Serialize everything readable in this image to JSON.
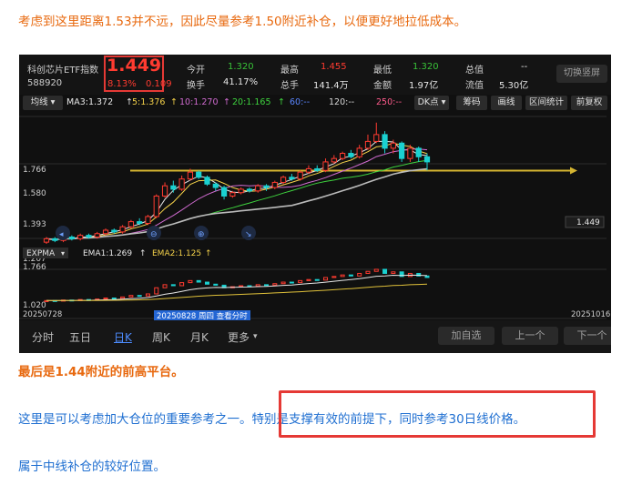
{
  "article": {
    "intro": "考虑到这里距离1.53并不远，因此尽量参考1.50附近补仓，以便更好地拉低成本。",
    "caption": "最后是1.44附近的前高平台。",
    "p2_plain": "这里是可以考虑加大仓位的重要参考之一。",
    "p2_highlight": "特别是支撑有效的前提下，同时参考30日线价格。",
    "p3": "属于中线补仓的较好位置。"
  },
  "quote": {
    "name": "科创芯片ETF指数",
    "code": "588920",
    "price": "1.449",
    "change_pct": "8.13%",
    "change_abs": "0.109",
    "stats": [
      {
        "label": "今开",
        "value": "1.320",
        "tone": "green"
      },
      {
        "label": "最高",
        "value": "1.455",
        "tone": "red"
      },
      {
        "label": "最低",
        "value": "1.320",
        "tone": "green"
      },
      {
        "label": "总值",
        "value": "--",
        "tone": "white"
      },
      {
        "label": "换手",
        "value": "41.17%",
        "tone": "white"
      },
      {
        "label": "总手",
        "value": "141.4万",
        "tone": "white"
      },
      {
        "label": "金额",
        "value": "1.97亿",
        "tone": "white"
      },
      {
        "label": "流值",
        "value": "5.30亿",
        "tone": "white"
      }
    ],
    "switch_button": "切换竖屏"
  },
  "toolbar": {
    "ma_select": "均线",
    "ma3": "MA3:1.372",
    "ma5": "5:1.376",
    "ma10": "10:1.270",
    "ma20": "20:1.165",
    "ma60": "60:--",
    "ma120": "120:--",
    "ma250": "250:--",
    "dk": "DK点",
    "chip": "筹码",
    "draw": "画线",
    "range": "区间统计",
    "adjust": "前复权"
  },
  "chart": {
    "y_labels": [
      "1.766",
      "1.580",
      "1.393",
      "1.207",
      "1.020"
    ],
    "price_tag": "1.449",
    "ema_select": "EXPMA",
    "ema1": "EMA1:1.269",
    "ema2": "EMA2:1.125",
    "sub_top": "1.766",
    "sub_bottom": "1.020",
    "date_start": "20250728",
    "date_end": "20251016",
    "cursor_date": "20250828 周四 查看分时"
  },
  "colors": {
    "up": "#ff3b30",
    "down": "#1ad1d1",
    "accent": "#e8690f",
    "link": "#1f6fd1",
    "highlight_box": "#e53935"
  },
  "chart_data": {
    "type": "candlestick",
    "title": "",
    "x_start": "20250728",
    "x_end": "20251016",
    "ylim": [
      1.02,
      1.766
    ],
    "support_level": 1.449,
    "candles": [
      {
        "o": 1.03,
        "c": 1.05,
        "h": 1.06,
        "l": 1.02
      },
      {
        "o": 1.05,
        "c": 1.04,
        "h": 1.06,
        "l": 1.03
      },
      {
        "o": 1.04,
        "c": 1.06,
        "h": 1.07,
        "l": 1.03
      },
      {
        "o": 1.06,
        "c": 1.05,
        "h": 1.07,
        "l": 1.04
      },
      {
        "o": 1.05,
        "c": 1.07,
        "h": 1.08,
        "l": 1.04
      },
      {
        "o": 1.07,
        "c": 1.06,
        "h": 1.08,
        "l": 1.05
      },
      {
        "o": 1.06,
        "c": 1.08,
        "h": 1.09,
        "l": 1.05
      },
      {
        "o": 1.08,
        "c": 1.1,
        "h": 1.11,
        "l": 1.07
      },
      {
        "o": 1.1,
        "c": 1.09,
        "h": 1.11,
        "l": 1.08
      },
      {
        "o": 1.09,
        "c": 1.12,
        "h": 1.13,
        "l": 1.08
      },
      {
        "o": 1.12,
        "c": 1.15,
        "h": 1.16,
        "l": 1.11
      },
      {
        "o": 1.15,
        "c": 1.14,
        "h": 1.17,
        "l": 1.13
      },
      {
        "o": 1.14,
        "c": 1.18,
        "h": 1.19,
        "l": 1.13
      },
      {
        "o": 1.18,
        "c": 1.3,
        "h": 1.31,
        "l": 1.17
      },
      {
        "o": 1.3,
        "c": 1.36,
        "h": 1.38,
        "l": 1.29
      },
      {
        "o": 1.36,
        "c": 1.34,
        "h": 1.39,
        "l": 1.32
      },
      {
        "o": 1.34,
        "c": 1.4,
        "h": 1.42,
        "l": 1.33
      },
      {
        "o": 1.4,
        "c": 1.44,
        "h": 1.46,
        "l": 1.39
      },
      {
        "o": 1.44,
        "c": 1.41,
        "h": 1.45,
        "l": 1.4
      },
      {
        "o": 1.41,
        "c": 1.37,
        "h": 1.42,
        "l": 1.36
      },
      {
        "o": 1.37,
        "c": 1.35,
        "h": 1.38,
        "l": 1.33
      },
      {
        "o": 1.35,
        "c": 1.3,
        "h": 1.36,
        "l": 1.28
      },
      {
        "o": 1.3,
        "c": 1.32,
        "h": 1.33,
        "l": 1.29
      },
      {
        "o": 1.32,
        "c": 1.34,
        "h": 1.35,
        "l": 1.31
      },
      {
        "o": 1.34,
        "c": 1.33,
        "h": 1.35,
        "l": 1.32
      },
      {
        "o": 1.33,
        "c": 1.36,
        "h": 1.37,
        "l": 1.32
      },
      {
        "o": 1.36,
        "c": 1.35,
        "h": 1.37,
        "l": 1.33
      },
      {
        "o": 1.35,
        "c": 1.38,
        "h": 1.39,
        "l": 1.34
      },
      {
        "o": 1.38,
        "c": 1.41,
        "h": 1.42,
        "l": 1.37
      },
      {
        "o": 1.41,
        "c": 1.4,
        "h": 1.43,
        "l": 1.39
      },
      {
        "o": 1.4,
        "c": 1.44,
        "h": 1.45,
        "l": 1.39
      },
      {
        "o": 1.44,
        "c": 1.46,
        "h": 1.48,
        "l": 1.43
      },
      {
        "o": 1.46,
        "c": 1.45,
        "h": 1.48,
        "l": 1.44
      },
      {
        "o": 1.45,
        "c": 1.5,
        "h": 1.52,
        "l": 1.44
      },
      {
        "o": 1.5,
        "c": 1.52,
        "h": 1.54,
        "l": 1.49
      },
      {
        "o": 1.52,
        "c": 1.55,
        "h": 1.56,
        "l": 1.51
      },
      {
        "o": 1.55,
        "c": 1.53,
        "h": 1.57,
        "l": 1.52
      },
      {
        "o": 1.53,
        "c": 1.58,
        "h": 1.6,
        "l": 1.52
      },
      {
        "o": 1.58,
        "c": 1.62,
        "h": 1.66,
        "l": 1.57
      },
      {
        "o": 1.62,
        "c": 1.66,
        "h": 1.73,
        "l": 1.61
      },
      {
        "o": 1.66,
        "c": 1.58,
        "h": 1.68,
        "l": 1.55
      },
      {
        "o": 1.58,
        "c": 1.61,
        "h": 1.63,
        "l": 1.55
      },
      {
        "o": 1.61,
        "c": 1.52,
        "h": 1.62,
        "l": 1.5
      },
      {
        "o": 1.52,
        "c": 1.58,
        "h": 1.6,
        "l": 1.5
      },
      {
        "o": 1.58,
        "c": 1.53,
        "h": 1.59,
        "l": 1.5
      },
      {
        "o": 1.53,
        "c": 1.5,
        "h": 1.55,
        "l": 1.45
      }
    ]
  },
  "bottom": {
    "tabs": [
      {
        "label": "分时",
        "active": false
      },
      {
        "label": "五日",
        "active": false
      },
      {
        "label": "日K",
        "active": true
      },
      {
        "label": "周K",
        "active": false
      },
      {
        "label": "月K",
        "active": false
      },
      {
        "label": "更多",
        "active": false
      }
    ],
    "add_watch": "加自选",
    "prev": "上一个",
    "next": "下一个"
  }
}
